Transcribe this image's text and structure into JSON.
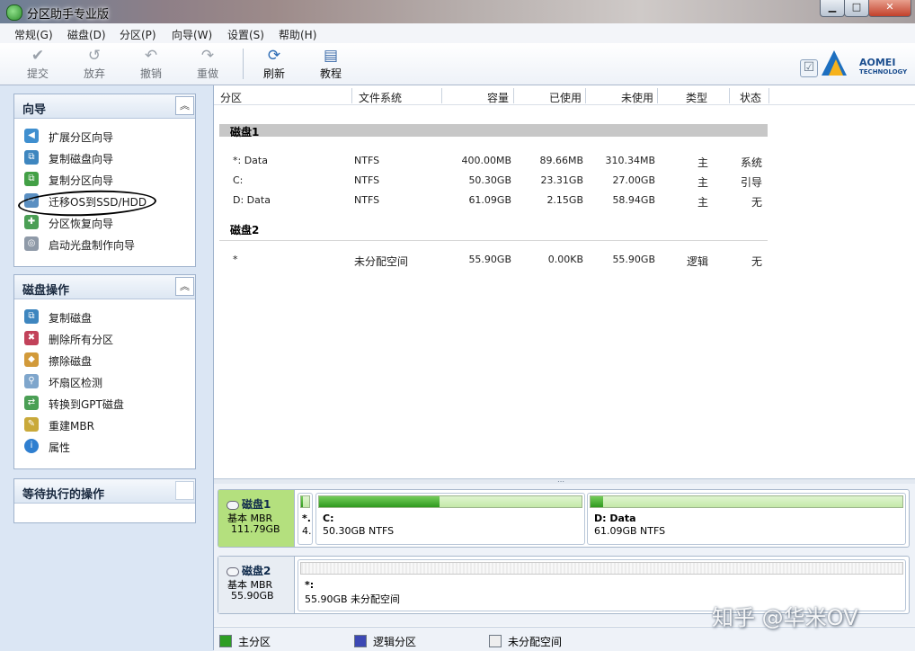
{
  "window": {
    "title": "分区助手专业版"
  },
  "menu": [
    "常规(G)",
    "磁盘(D)",
    "分区(P)",
    "向导(W)",
    "设置(S)",
    "帮助(H)"
  ],
  "toolbar": {
    "commit": "提交",
    "discard": "放弃",
    "undo": "撤销",
    "redo": "重做",
    "refresh": "刷新",
    "tutorial": "教程"
  },
  "logo": {
    "brand": "AOMEI",
    "sub": "TECHNOLOGY"
  },
  "wizard_panel": {
    "title": "向导",
    "items": [
      "扩展分区向导",
      "复制磁盘向导",
      "复制分区向导",
      "迁移OS到SSD/HDD",
      "分区恢复向导",
      "启动光盘制作向导"
    ]
  },
  "disk_ops_panel": {
    "title": "磁盘操作",
    "items": [
      "复制磁盘",
      "删除所有分区",
      "擦除磁盘",
      "坏扇区检测",
      "转换到GPT磁盘",
      "重建MBR",
      "属性"
    ]
  },
  "pending_panel": {
    "title": "等待执行的操作"
  },
  "columns": [
    "分区",
    "文件系统",
    "容量",
    "已使用",
    "未使用",
    "类型",
    "状态"
  ],
  "disks": [
    {
      "name": "磁盘1",
      "partitions": [
        {
          "name": "*: Data",
          "fs": "NTFS",
          "capacity": "400.00MB",
          "used": "89.66MB",
          "free": "310.34MB",
          "type": "主",
          "status": "系统"
        },
        {
          "name": "C:",
          "fs": "NTFS",
          "capacity": "50.30GB",
          "used": "23.31GB",
          "free": "27.00GB",
          "type": "主",
          "status": "引导"
        },
        {
          "name": "D: Data",
          "fs": "NTFS",
          "capacity": "61.09GB",
          "used": "2.15GB",
          "free": "58.94GB",
          "type": "主",
          "status": "无"
        }
      ]
    },
    {
      "name": "磁盘2",
      "partitions": [
        {
          "name": "*",
          "fs": "未分配空间",
          "capacity": "55.90GB",
          "used": "0.00KB",
          "free": "55.90GB",
          "type": "逻辑",
          "status": "无"
        }
      ]
    }
  ],
  "disk_map": [
    {
      "name": "磁盘1",
      "type": "基本 MBR",
      "size": "111.79GB",
      "parts": [
        {
          "label": "*.",
          "desc": "4.",
          "used_fraction": 0.22
        },
        {
          "label": "C:",
          "desc": "50.30GB NTFS",
          "used_fraction": 0.46
        },
        {
          "label": "D: Data",
          "desc": "61.09GB NTFS",
          "used_fraction": 0.04
        }
      ]
    },
    {
      "name": "磁盘2",
      "type": "基本 MBR",
      "size": "55.90GB",
      "parts": [
        {
          "label": "*:",
          "desc": "55.90GB 未分配空间",
          "used_fraction": 0
        }
      ]
    }
  ],
  "legend": [
    {
      "label": "主分区",
      "color": "#2e9e24"
    },
    {
      "label": "逻辑分区",
      "color": "#3c48b4"
    },
    {
      "label": "未分配空间",
      "color": "#eeeeee"
    }
  ],
  "watermark": "知乎 @华米OV"
}
